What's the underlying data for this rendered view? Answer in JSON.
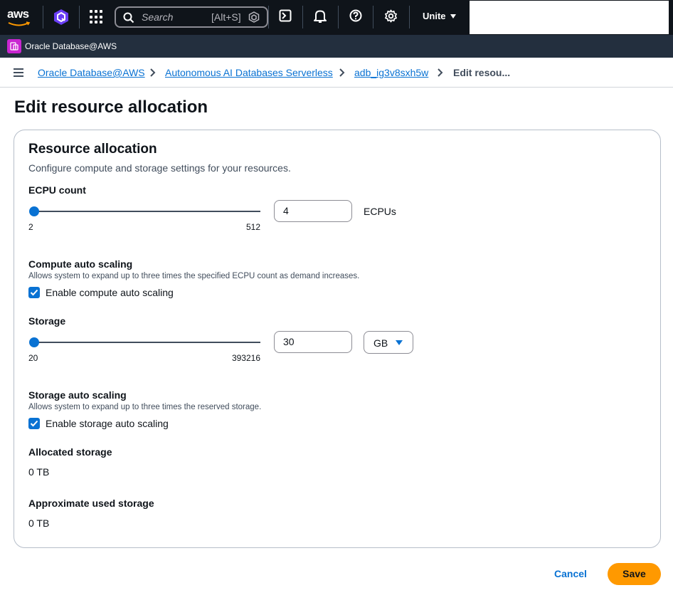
{
  "topnav": {
    "logo": "aws",
    "search_placeholder": "Search",
    "search_shortcut": "[Alt+S]",
    "account_label": "Unite",
    "icons": [
      "amazon-q-icon",
      "apps-grid-icon",
      "search-icon",
      "cloudshell-icon",
      "notifications-bell-icon",
      "help-icon",
      "settings-gear-icon",
      "caret-down-icon"
    ]
  },
  "service_bar": {
    "label": "Oracle Database@AWS"
  },
  "breadcrumb": {
    "items": [
      "Oracle Database@AWS",
      "Autonomous AI Databases Serverless",
      "adb_ig3v8sxh5w",
      "Edit resou..."
    ]
  },
  "page": {
    "title": "Edit resource allocation"
  },
  "panel": {
    "title": "Resource allocation",
    "description": "Configure compute and storage settings for your resources.",
    "ecpu": {
      "label": "ECPU count",
      "min": "2",
      "max": "512",
      "value": "4",
      "unit": "ECPUs"
    },
    "compute_auto_scaling": {
      "label": "Compute auto scaling",
      "description": "Allows system to expand up to three times the specified ECPU count as demand increases.",
      "checkbox_label": "Enable compute auto scaling",
      "checked": true
    },
    "storage": {
      "label": "Storage",
      "min": "20",
      "max": "393216",
      "value": "30",
      "unit_selected": "GB"
    },
    "storage_auto_scaling": {
      "label": "Storage auto scaling",
      "description": "Allows system to expand up to three times the reserved storage.",
      "checkbox_label": "Enable storage auto scaling",
      "checked": true
    },
    "allocated_storage": {
      "label": "Allocated storage",
      "value": "0 TB"
    },
    "used_storage": {
      "label": "Approximate used storage",
      "value": "0 TB"
    }
  },
  "actions": {
    "cancel": "Cancel",
    "save": "Save"
  },
  "colors": {
    "nav_bg": "#0f141a",
    "service_bar_bg": "#232f3e",
    "link_blue": "#0972d3",
    "primary_orange": "#ff9900",
    "service_icon_magenta": "#c925d1"
  }
}
